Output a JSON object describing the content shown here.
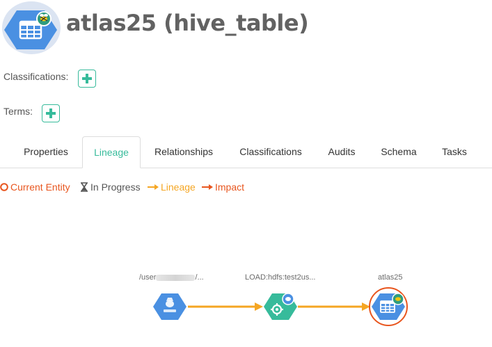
{
  "header": {
    "title": "atlas25 (hive_table)",
    "entity_icon": "hive-table-icon",
    "badge_icon": "hive-bee-icon"
  },
  "classifications": {
    "label": "Classifications:",
    "add_icon": "plus-icon"
  },
  "terms": {
    "label": "Terms:",
    "add_icon": "plus-icon"
  },
  "tabs": [
    {
      "label": "Properties",
      "active": false
    },
    {
      "label": "Lineage",
      "active": true
    },
    {
      "label": "Relationships",
      "active": false
    },
    {
      "label": "Classifications",
      "active": false
    },
    {
      "label": "Audits",
      "active": false
    },
    {
      "label": "Schema",
      "active": false
    },
    {
      "label": "Tasks",
      "active": false
    }
  ],
  "legend": {
    "current_entity": "Current Entity",
    "in_progress": "In Progress",
    "lineage": "Lineage",
    "impact": "Impact"
  },
  "lineage_graph": {
    "nodes": [
      {
        "label_prefix": "/user",
        "label_suffix": "/...",
        "type": "hdfs_path",
        "icon": "hdfs-icon",
        "color": "#4a90e2"
      },
      {
        "label": "LOAD:hdfs:test2us...",
        "type": "process",
        "icon": "gear-icon",
        "color": "#37bb9b"
      },
      {
        "label": "atlas25",
        "type": "hive_table",
        "icon": "hive-table-icon",
        "color": "#4a90e2",
        "current": true
      }
    ],
    "edge_color": "#f5a623"
  },
  "colors": {
    "accent": "#37bb9b",
    "current_entity": "#e8561f",
    "lineage": "#f5a623",
    "impact": "#e8561f",
    "entity_blue": "#4a90e2"
  }
}
